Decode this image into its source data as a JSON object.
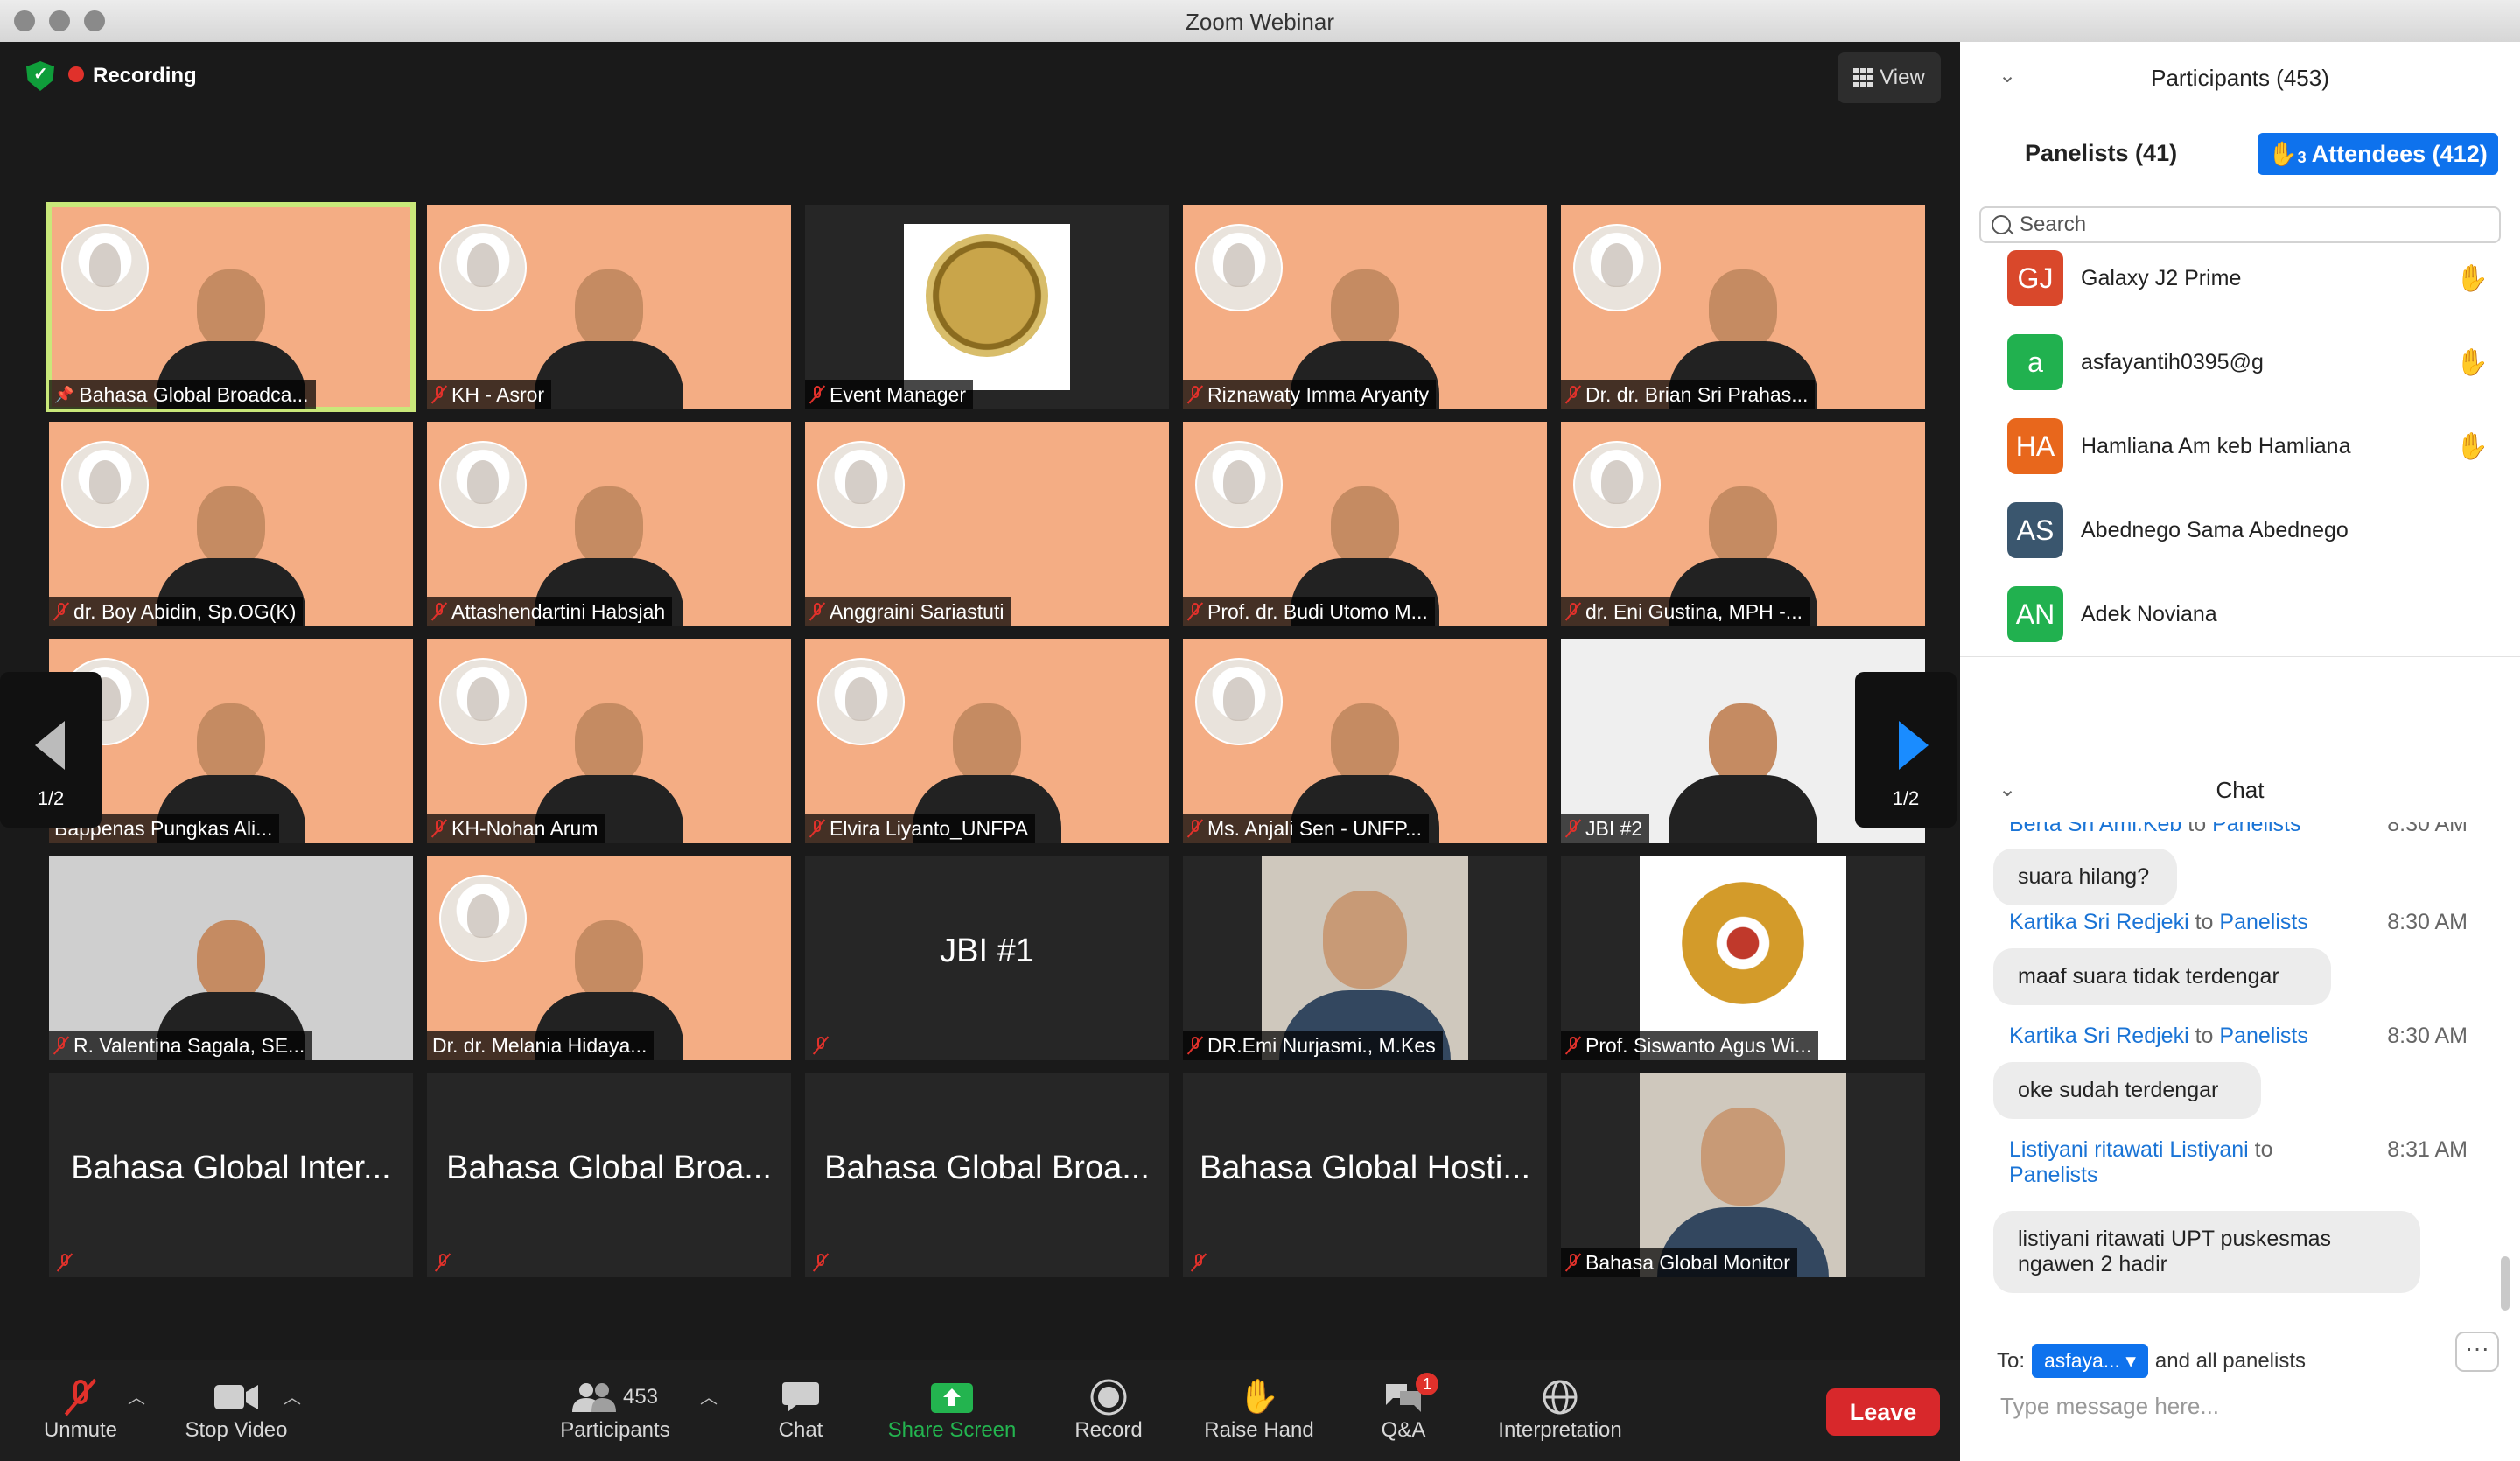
{
  "window": {
    "title": "Zoom Webinar"
  },
  "status": {
    "recording_label": "Recording"
  },
  "view_button": {
    "label": "View"
  },
  "page_indicator": {
    "left": "1/2",
    "right": "1/2"
  },
  "tiles": [
    {
      "name": "Bahasa Global Broadca...",
      "style": "slide",
      "muted": false,
      "pinned": true
    },
    {
      "name": "KH - Asror",
      "style": "person",
      "muted": true
    },
    {
      "name": "Event Manager",
      "style": "logo",
      "muted": true
    },
    {
      "name": "Riznawaty Imma Aryanty",
      "style": "person",
      "muted": true
    },
    {
      "name": "Dr. dr. Brian Sri Prahas...",
      "style": "person",
      "muted": true
    },
    {
      "name": "dr. Boy Abidin, Sp.OG(K)",
      "style": "person",
      "muted": true
    },
    {
      "name": "Attashendartini Habsjah",
      "style": "person",
      "muted": true
    },
    {
      "name": "Anggraini Sariastuti",
      "style": "empty",
      "muted": true
    },
    {
      "name": "Prof. dr. Budi Utomo M...",
      "style": "person",
      "muted": true
    },
    {
      "name": "dr. Eni Gustina, MPH -...",
      "style": "person",
      "muted": true
    },
    {
      "name": "Bappenas Pungkas Ali...",
      "style": "person",
      "muted": false
    },
    {
      "name": "KH-Nohan Arum",
      "style": "person",
      "muted": true
    },
    {
      "name": "Elvira Liyanto_UNFPA",
      "style": "person",
      "muted": true
    },
    {
      "name": "Ms. Anjali Sen - UNFP...",
      "style": "person",
      "muted": true
    },
    {
      "name": "JBI #2",
      "style": "white",
      "muted": true
    },
    {
      "name": "R. Valentina Sagala, SE...",
      "style": "gray",
      "muted": true
    },
    {
      "name": "Dr. dr. Melania Hidaya...",
      "style": "person",
      "muted": false
    },
    {
      "name": "JBI #1",
      "style": "dark-big",
      "muted": true
    },
    {
      "name": "DR.Emi Nurjasmi., M.Kes",
      "style": "photo",
      "muted": true
    },
    {
      "name": "Prof. Siswanto Agus Wi...",
      "style": "emblem",
      "muted": true
    },
    {
      "name": "Bahasa Global Inter...",
      "style": "dark-big",
      "muted": true
    },
    {
      "name": "Bahasa Global Broa...",
      "style": "dark-big",
      "muted": true
    },
    {
      "name": "Bahasa Global Broa...",
      "style": "dark-big",
      "muted": true
    },
    {
      "name": "Bahasa Global Hosti...",
      "style": "dark-big",
      "muted": true
    },
    {
      "name": "Bahasa Global Monitor",
      "style": "photo",
      "muted": true
    }
  ],
  "toolbar": {
    "unmute": "Unmute",
    "stop_video": "Stop Video",
    "participants": "Participants",
    "participants_count": "453",
    "chat": "Chat",
    "share_screen": "Share Screen",
    "record": "Record",
    "raise_hand": "Raise Hand",
    "qa": "Q&A",
    "qa_badge": "1",
    "interpretation": "Interpretation",
    "leave": "Leave"
  },
  "participants_panel": {
    "title": "Participants (453)",
    "tab_panelists": "Panelists (41)",
    "tab_attendees_hand": "3",
    "tab_attendees": "Attendees (412)",
    "search_placeholder": "Search",
    "list": [
      {
        "initials": "GJ",
        "name": "Galaxy J2 Prime",
        "color": "#d9482b",
        "hand": true
      },
      {
        "initials": "a",
        "name": "asfayantih0395@g",
        "color": "#21b14f",
        "hand": true
      },
      {
        "initials": "HA",
        "name": "Hamliana Am keb Hamliana",
        "color": "#e8671c",
        "hand": true
      },
      {
        "initials": "AS",
        "name": "Abednego Sama Abednego",
        "color": "#3a566e",
        "hand": false
      },
      {
        "initials": "AN",
        "name": "Adek Noviana",
        "color": "#21b14f",
        "hand": false
      }
    ]
  },
  "chat_panel": {
    "title": "Chat",
    "messages": [
      {
        "from": "Berta Sri Ami.Keb",
        "to_word": "to",
        "to": "Panelists",
        "time": "8:30 AM",
        "text": "suara hilang?"
      },
      {
        "from": "Kartika Sri Redjeki",
        "to_word": "to",
        "to": "Panelists",
        "time": "8:30 AM",
        "text": "maaf suara tidak terdengar"
      },
      {
        "from": "Kartika Sri Redjeki",
        "to_word": "to",
        "to": "Panelists",
        "time": "8:30 AM",
        "text": "oke sudah terdengar"
      },
      {
        "from": "Listiyani ritawati Listiyani",
        "to_word": "to",
        "to": "Panelists",
        "time": "8:31 AM",
        "text": "listiyani ritawati UPT puskesmas ngawen 2 hadir"
      }
    ],
    "to_label": "To:",
    "to_selected": "asfaya...",
    "to_suffix": "and all panelists",
    "input_placeholder": "Type message here..."
  }
}
